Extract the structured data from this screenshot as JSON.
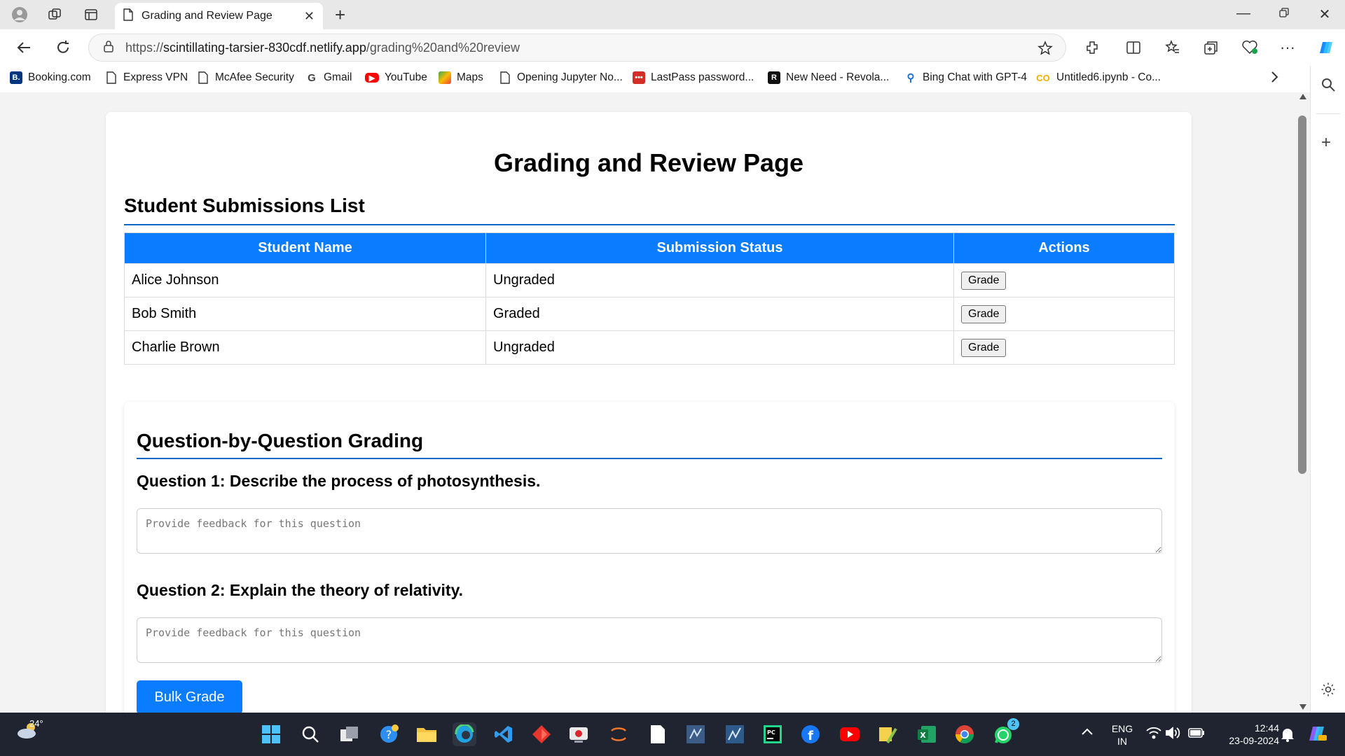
{
  "browser": {
    "tab_title": "Grading and Review Page",
    "url_prefix": "https://",
    "url_host": "scintillating-tarsier-830cdf.netlify.app",
    "url_path": "/grading%20and%20review",
    "bookmarks": [
      {
        "label": "Booking.com",
        "icon": "booking-icon",
        "color": "#003580"
      },
      {
        "label": "Express VPN",
        "icon": "page-icon"
      },
      {
        "label": "McAfee Security",
        "icon": "page-icon"
      },
      {
        "label": "Gmail",
        "icon": "google-icon"
      },
      {
        "label": "YouTube",
        "icon": "youtube-icon",
        "color": "#ff0000"
      },
      {
        "label": "Maps",
        "icon": "maps-icon"
      },
      {
        "label": "Opening Jupyter No...",
        "icon": "page-icon"
      },
      {
        "label": "LastPass password...",
        "icon": "lastpass-icon",
        "color": "#d32d27"
      },
      {
        "label": "New Need - Revola...",
        "icon": "revola-icon"
      },
      {
        "label": "Bing Chat with GPT-4",
        "icon": "search-icon"
      },
      {
        "label": "Untitled6.ipynb - Co...",
        "icon": "colab-icon",
        "color": "#f9ab00"
      }
    ]
  },
  "page": {
    "title": "Grading and Review Page",
    "submissions": {
      "heading": "Student Submissions List",
      "columns": [
        "Student Name",
        "Submission Status",
        "Actions"
      ],
      "rows": [
        {
          "name": "Alice Johnson",
          "status": "Ungraded",
          "action": "Grade"
        },
        {
          "name": "Bob Smith",
          "status": "Graded",
          "action": "Grade"
        },
        {
          "name": "Charlie Brown",
          "status": "Ungraded",
          "action": "Grade"
        }
      ]
    },
    "grading": {
      "heading": "Question-by-Question Grading",
      "questions": [
        {
          "label": "Question 1: Describe the process of photosynthesis.",
          "placeholder": "Provide feedback for this question"
        },
        {
          "label": "Question 2: Explain the theory of relativity.",
          "placeholder": "Provide feedback for this question"
        }
      ],
      "bulk_button": "Bulk Grade"
    }
  },
  "taskbar": {
    "temperature": "24°",
    "language_top": "ENG",
    "language_bottom": "IN",
    "time": "12:44",
    "date": "23-09-2024",
    "whatsapp_badge": "2"
  },
  "colors": {
    "accent": "#0a7cff",
    "rule": "#0a66c2"
  }
}
